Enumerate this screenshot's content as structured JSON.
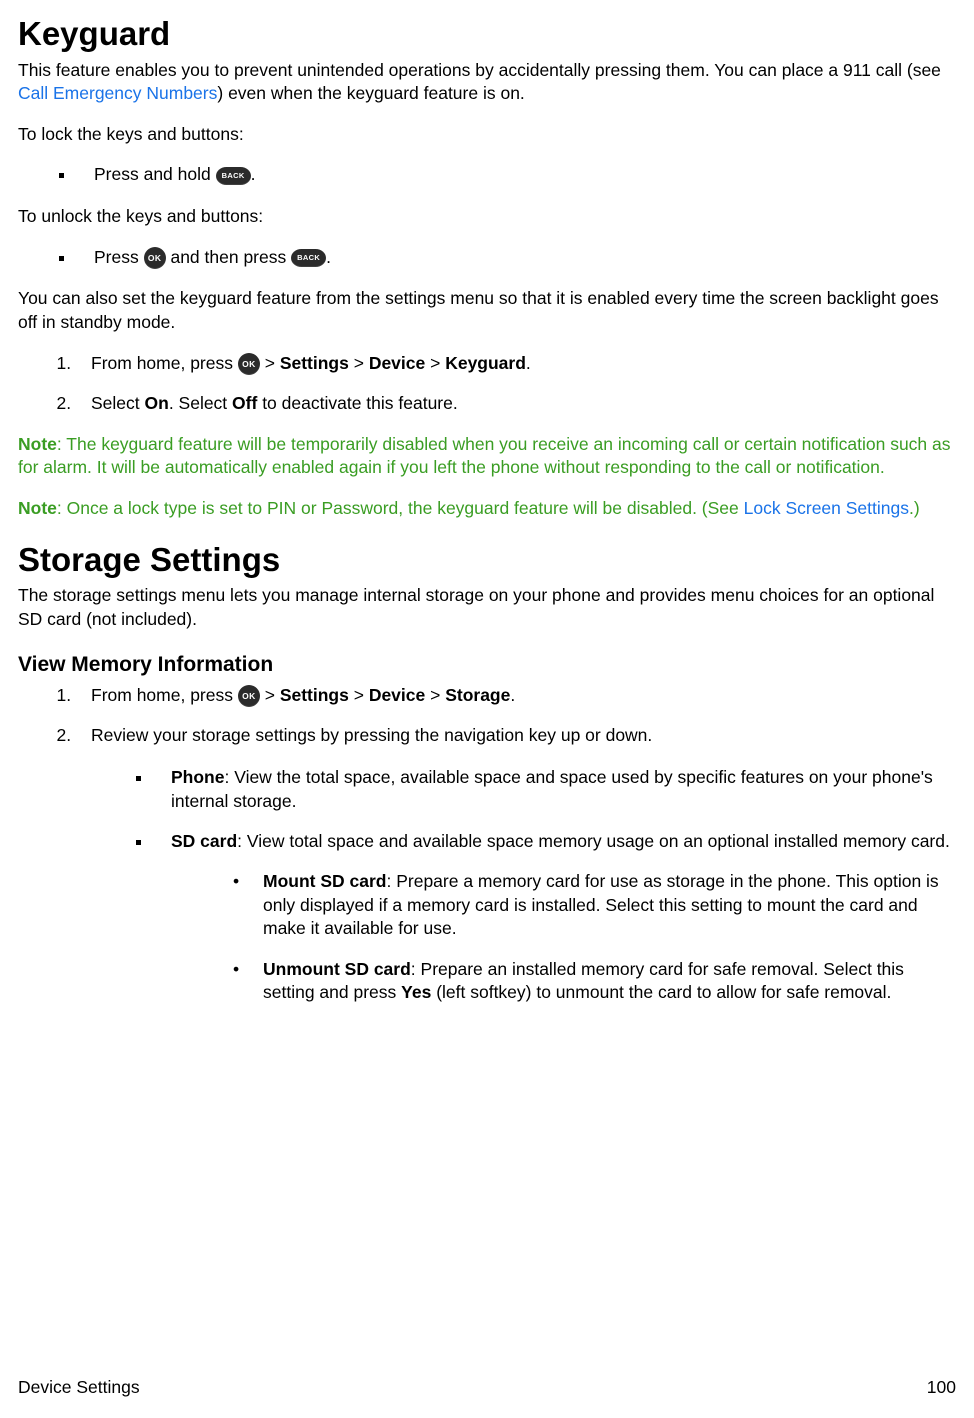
{
  "keyguard": {
    "heading": "Keyguard",
    "intro_pre": "This feature enables you to prevent unintended operations by accidentally pressing them. You can place a 911 call (see ",
    "intro_link": "Call Emergency Numbers",
    "intro_post": ") even when the keyguard feature is on.",
    "lock_heading": "To lock the keys and buttons:",
    "lock_step_pre": "Press and hold ",
    "back_key_label": "BACK",
    "ok_key_label": "OK",
    "period": ".",
    "unlock_heading": "To unlock the keys and buttons:",
    "unlock_step_pre": "Press ",
    "unlock_step_mid": " and then press ",
    "persist_text": "You can also set the keyguard feature from the settings menu so that it is enabled every time the screen backlight goes off in standby mode.",
    "step1_pre": "From home, press ",
    "gt": " > ",
    "settings": "Settings",
    "device": "Device",
    "keyguard": "Keyguard",
    "step2_pre": "Select ",
    "on": "On",
    "step2_mid": ". Select ",
    "off": "Off",
    "step2_post": " to deactivate this feature.",
    "note_label": "Note",
    "note1_text": ": The keyguard feature will be temporarily disabled when you receive an incoming call or certain notification such as for alarm. It will be automatically enabled again if you left the phone without responding to the call or notification.",
    "note2_pre": ": Once a lock type is set to PIN or Password, the keyguard feature will be disabled. (See ",
    "note2_link": "Lock Screen Settings",
    "note2_post": ".)"
  },
  "storage": {
    "heading": "Storage Settings",
    "intro": "The storage settings menu lets you manage internal storage on your phone and provides menu choices for an optional SD card (not included).",
    "view_heading": "View Memory Information",
    "step1_pre": "From home, press ",
    "storage_label": "Storage",
    "step2": "Review your storage settings by pressing the navigation key up or down.",
    "phone_label": "Phone",
    "phone_desc": ": View the total space, available space and space used by specific features on your phone's internal storage.",
    "sd_label": "SD card",
    "sd_desc": ": View total space and available space memory usage on an optional installed memory card.",
    "mount_label": "Mount SD card",
    "mount_desc": ": Prepare a memory card for use as storage in the phone. This option is only displayed if a memory card is installed. Select this setting to mount the card and make it available for use.",
    "unmount_label": "Unmount SD card",
    "unmount_pre": ": Prepare an installed memory card for safe removal. Select this setting and press ",
    "yes": "Yes",
    "unmount_post": " (left softkey) to unmount the card to allow for safe removal."
  },
  "footer": {
    "section": "Device Settings",
    "page": "100"
  }
}
